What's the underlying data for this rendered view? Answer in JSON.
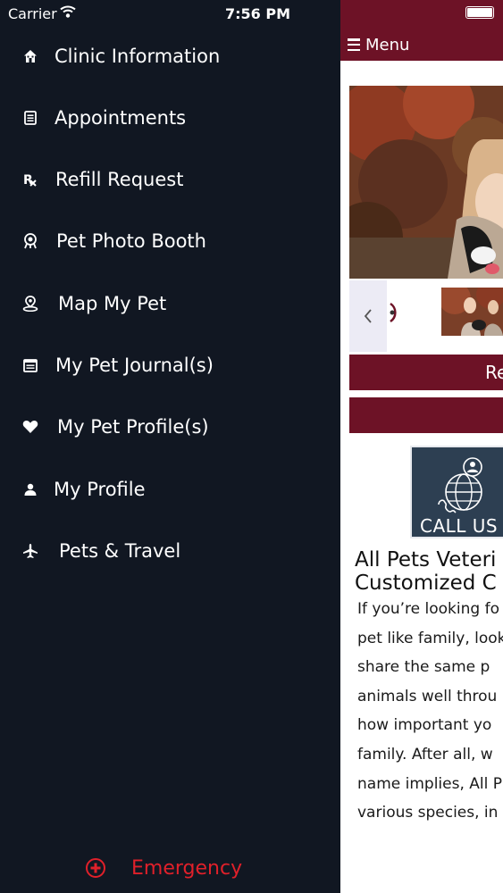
{
  "status_bar": {
    "carrier": "Carrier",
    "time": "7:56 PM"
  },
  "drawer": {
    "items": [
      {
        "label": "Clinic Information",
        "icon": "home-icon"
      },
      {
        "label": "Appointments",
        "icon": "calendar-list-icon"
      },
      {
        "label": "Refill Request",
        "icon": "rx-icon"
      },
      {
        "label": "Pet Photo Booth",
        "icon": "camera-icon"
      },
      {
        "label": "Map My Pet",
        "icon": "map-pin-icon"
      },
      {
        "label": "My Pet Journal(s)",
        "icon": "journal-icon"
      },
      {
        "label": "My Pet Profile(s)",
        "icon": "heart-icon"
      },
      {
        "label": "My Profile",
        "icon": "person-icon"
      },
      {
        "label": "Pets & Travel",
        "icon": "airplane-icon"
      }
    ],
    "emergency": {
      "label": "Emergency",
      "icon": "plus-circle-icon",
      "color": "#e0202a"
    }
  },
  "content": {
    "menu_label": "Menu",
    "bar_button_label": "Re",
    "call_us_label": "CALL US",
    "heading_lines": [
      "All Pets Veteri",
      "Customized C"
    ],
    "paragraph_lines": [
      "If you’re looking fo",
      "pet like family, look",
      "share the same p",
      "animals well throu",
      "how important yo",
      "family.  After all, w",
      "name implies, All P",
      "various species, in"
    ]
  },
  "colors": {
    "drawer_bg": "#111722",
    "brand": "#6d1226",
    "call_us_bg": "#2d3f52"
  }
}
